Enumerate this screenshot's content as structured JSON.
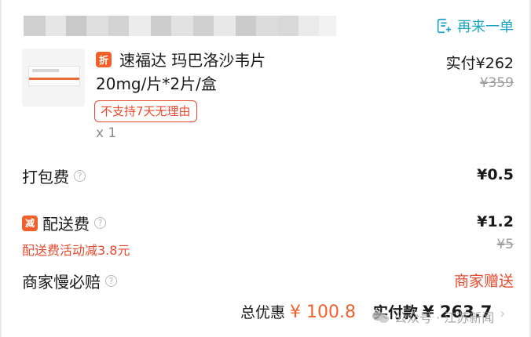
{
  "store": {
    "name_blurred": true
  },
  "header": {
    "reorder_label": "再来一单"
  },
  "product": {
    "discount_badge": "折",
    "name": "速福达 玛巴洛沙韦片",
    "spec": "20mg/片*2片/盒",
    "tag": "不支持7天无理由",
    "quantity": "x 1",
    "actual_price": "实付¥262",
    "original_price": "¥359"
  },
  "fees": {
    "packing": {
      "label": "打包费",
      "value": "¥0.5"
    },
    "delivery": {
      "badge": "减",
      "label": "配送费",
      "value": "¥1.2",
      "original": "¥5",
      "promo_note": "配送费活动减3.8元"
    },
    "late_comp": {
      "label": "商家慢必赔",
      "value": "商家赠送"
    }
  },
  "footer": {
    "total_discount_label": "总优惠",
    "total_discount_value": "¥ 100.8",
    "paid_label": "实付款",
    "paid_value": "¥ 263.7"
  },
  "watermark": {
    "text": "公众号 · 江苏新闻"
  },
  "colors": {
    "accent": "#f1602b",
    "link": "#1aa3c4",
    "promo": "#e64a2e"
  }
}
